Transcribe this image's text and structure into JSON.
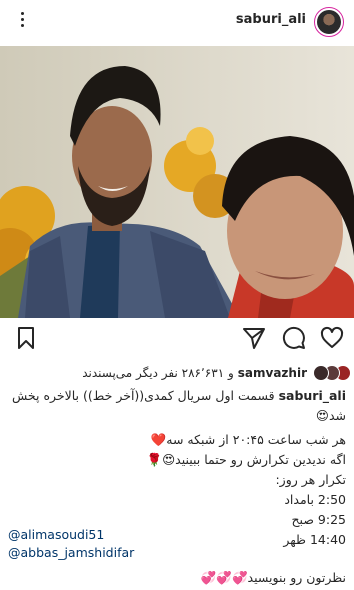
{
  "header": {
    "username": "saburi_ali",
    "menu_icon": "more-vertical-icon",
    "avatar_icon": "profile-avatar"
  },
  "actions": {
    "icons": [
      "heart-icon",
      "comment-icon",
      "share-icon",
      "bookmark-icon"
    ]
  },
  "likes": {
    "liked_by": "samvazhir",
    "rest": "و ۲۸۶٬۶۳۱ نفر دیگر می‌پسندند"
  },
  "caption": {
    "author": "saburi_ali",
    "line1": "قسمت اول سریال کمدی((آخر خط)) بالاخره پخش",
    "line2": "شد😍",
    "line3": "هر شب ساعت ۲۰:۴۵ از شبکه سه❤️",
    "line4": "اگه ندیدین تکرارش رو حتما ببینید😍🌹",
    "line5": "تکرار هر روز:",
    "line6": "2:50 بامداد",
    "line7": "9:25 صبح",
    "line8": "14:40 ظهر"
  },
  "mentions": [
    "@alimasoudi51",
    "@abbas_jamshidifar"
  ],
  "comment_prompt": "نظرتون رو بنویسید💞💞💞"
}
